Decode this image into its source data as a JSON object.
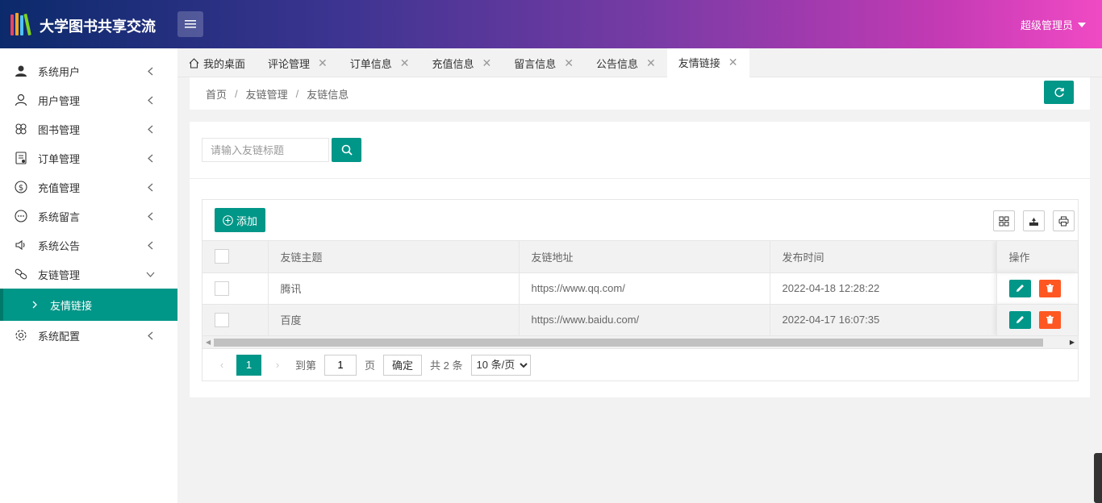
{
  "header": {
    "app_title": "大学图书共享交流",
    "user_label": "超级管理员"
  },
  "sidebar": {
    "items": [
      {
        "label": "系统用户",
        "icon": "user-solid-icon"
      },
      {
        "label": "用户管理",
        "icon": "user-outline-icon"
      },
      {
        "label": "图书管理",
        "icon": "clover-icon"
      },
      {
        "label": "订单管理",
        "icon": "receipt-icon"
      },
      {
        "label": "充值管理",
        "icon": "dollar-icon"
      },
      {
        "label": "系统留言",
        "icon": "chat-dots-icon"
      },
      {
        "label": "系统公告",
        "icon": "speaker-icon"
      },
      {
        "label": "友链管理",
        "icon": "link-icon"
      },
      {
        "label": "系统配置",
        "icon": "gear-icon"
      }
    ],
    "active_sub_item": "友情链接"
  },
  "tabs": [
    {
      "label": "我的桌面",
      "closable": false
    },
    {
      "label": "评论管理",
      "closable": true
    },
    {
      "label": "订单信息",
      "closable": true
    },
    {
      "label": "充值信息",
      "closable": true
    },
    {
      "label": "留言信息",
      "closable": true
    },
    {
      "label": "公告信息",
      "closable": true
    },
    {
      "label": "友情链接",
      "closable": true,
      "active": true
    }
  ],
  "breadcrumb": {
    "home": "首页",
    "section": "友链管理",
    "current": "友链信息",
    "separator": "/"
  },
  "search": {
    "placeholder": "请输入友链标题",
    "value": ""
  },
  "toolbar": {
    "add_label": "添加"
  },
  "table": {
    "columns": [
      "友链主题",
      "友链地址",
      "发布时间",
      "操作"
    ],
    "rows": [
      {
        "title": "腾讯",
        "url": "https://www.qq.com/",
        "time": "2022-04-18 12:28:22"
      },
      {
        "title": "百度",
        "url": "https://www.baidu.com/",
        "time": "2022-04-17 16:07:35"
      }
    ]
  },
  "pager": {
    "current_page": "1",
    "goto_label": "到第",
    "goto_value": "1",
    "page_unit": "页",
    "confirm_label": "确定",
    "total_label": "共 2 条",
    "page_size": "10 条/页"
  },
  "colors": {
    "primary": "#009688",
    "danger": "#ff5722"
  }
}
